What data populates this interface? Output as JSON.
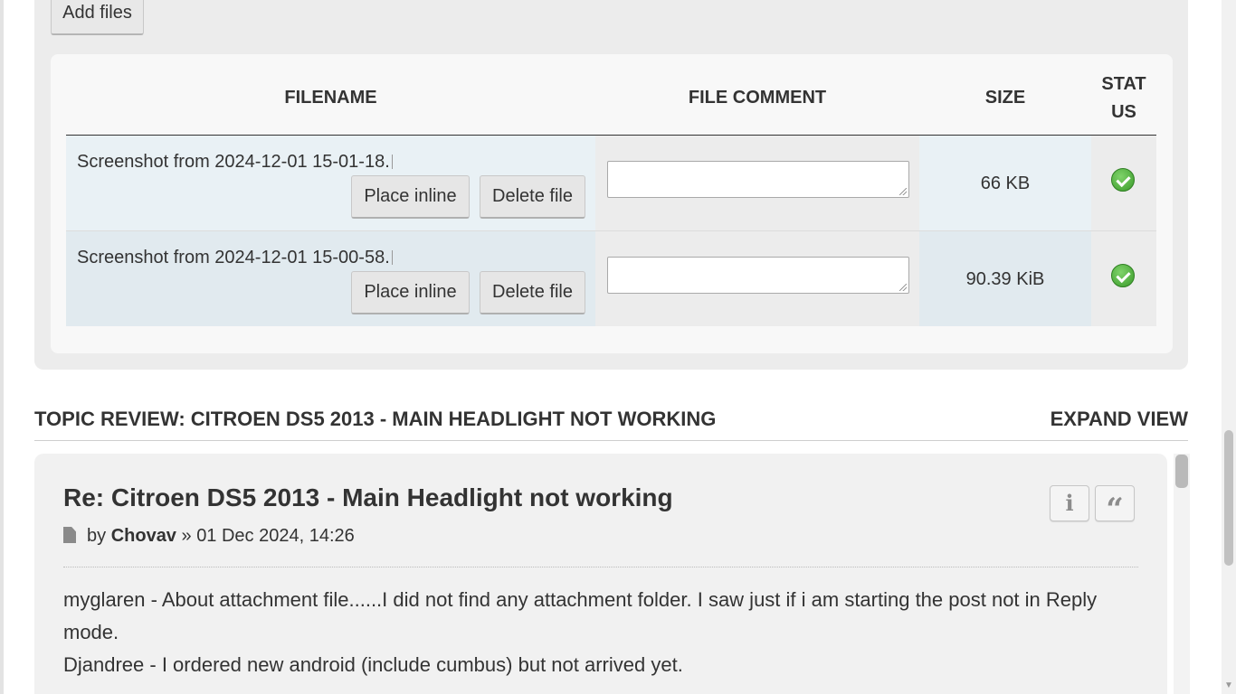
{
  "attachments": {
    "add_files_label": "Add files",
    "headers": {
      "filename": "FILENAME",
      "comment": "FILE COMMENT",
      "size": "SIZE",
      "status_line1": "STAT",
      "status_line2": "US"
    },
    "files": [
      {
        "filename": "Screenshot from 2024-12-01 15-01-18.",
        "comment": "",
        "size": "66 KB",
        "status": "ok"
      },
      {
        "filename": "Screenshot from 2024-12-01 15-00-58.",
        "comment": "",
        "size": "90.39 KiB",
        "status": "ok"
      }
    ],
    "place_inline_label": "Place inline",
    "delete_file_label": "Delete file",
    "status_color": "#3a9a2a"
  },
  "topic_review": {
    "title": "TOPIC REVIEW: CITROEN DS5 2013 - MAIN HEADLIGHT NOT WORKING",
    "expand_label": "EXPAND VIEW"
  },
  "post": {
    "title": "Re: Citroen DS5 2013 - Main Headlight not working",
    "by": "by",
    "author": "Chovav",
    "separator": "»",
    "date": "01 Dec 2024, 14:26",
    "body_lines": [
      "myglaren - About attachment file......I did not find any attachment folder. I saw just if i am starting the post not in Reply mode.",
      "Djandree - I ordered new android (include cumbus) but not arrived yet."
    ],
    "info_icon": "info-icon",
    "quote_icon": "quote-icon"
  }
}
